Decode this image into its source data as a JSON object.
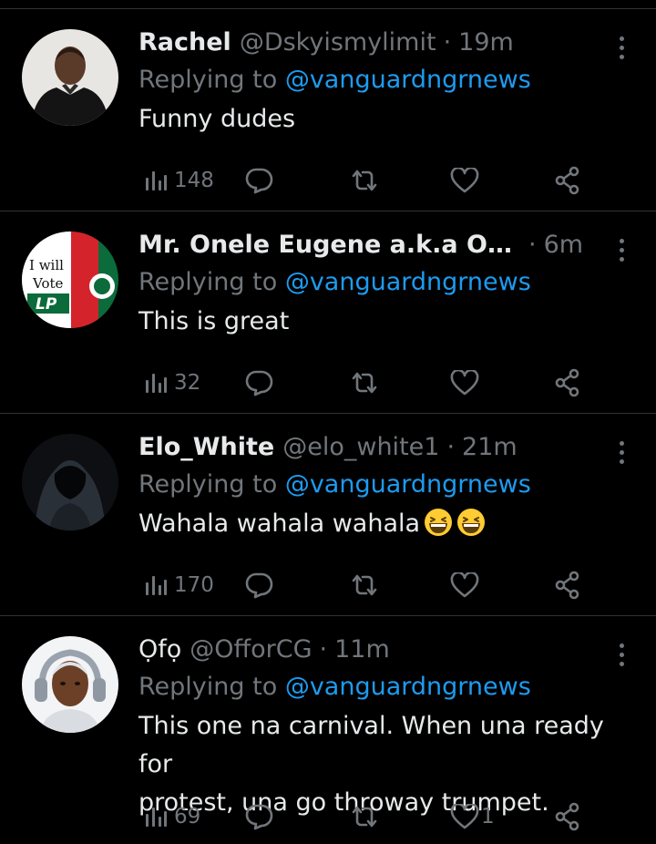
{
  "tweets": [
    {
      "name": "Rachel",
      "handle": "@Dskyismylimit",
      "sep": "·",
      "time": "19m",
      "replying_prefix": "Replying to",
      "replying_to": "@vanguardngrnews",
      "text": "Funny dudes",
      "views": "148",
      "likes": "",
      "avatar": "man-in-black-shirt"
    },
    {
      "name": "Mr. Onele Eugene a.k.a Obic...",
      "handle": "",
      "sep": "·",
      "time": "6m",
      "replying_prefix": "Replying to",
      "replying_to": "@vanguardngrnews",
      "text": "This is great",
      "views": "32",
      "likes": "",
      "avatar": "i-will-vote-lp-badge",
      "avatar_text": {
        "line1": "I will",
        "line2": "Vote",
        "line3": "LP"
      }
    },
    {
      "name": "Elo_White",
      "handle": "@elo_white1",
      "sep": "·",
      "time": "21m",
      "replying_prefix": "Replying to",
      "replying_to": "@vanguardngrnews",
      "text": "Wahala wahala wahala",
      "emojis": [
        "grinning-squinting-face",
        "grinning-squinting-face"
      ],
      "views": "170",
      "likes": "",
      "avatar": "hooded-figure"
    },
    {
      "name": "Ọfọ",
      "handle": "@OfforCG",
      "sep": "·",
      "time": "11m",
      "replying_prefix": "Replying to",
      "replying_to": "@vanguardngrnews",
      "text_line1": "This one na carnival. When una ready for",
      "text_line2": "protest, una go throway trumpet.",
      "views": "69",
      "likes": "1",
      "avatar": "woman-with-headphones"
    }
  ],
  "colors": {
    "background": "#000000",
    "text": "#e7e9ea",
    "muted": "#71767b",
    "link": "#1d9bf0",
    "divider": "#2f3336"
  }
}
